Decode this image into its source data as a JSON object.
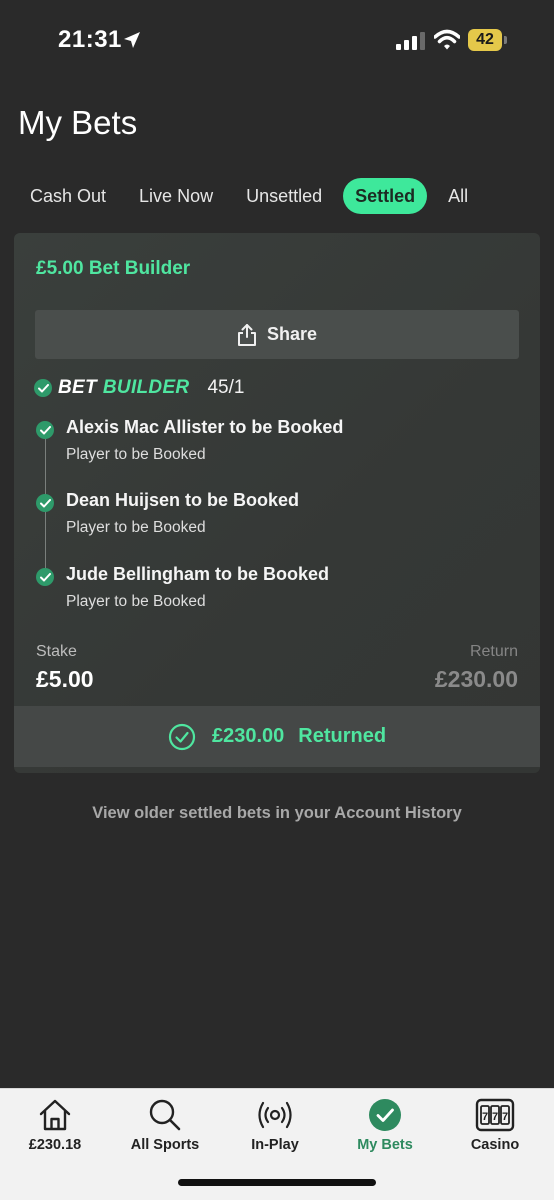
{
  "status_bar": {
    "time": "21:31",
    "battery": "42",
    "icons": [
      "location-arrow-icon",
      "signal-icon",
      "wifi-icon",
      "battery-icon"
    ]
  },
  "page": {
    "title": "My Bets"
  },
  "tabs": [
    {
      "label": "Cash Out",
      "active": false
    },
    {
      "label": "Live Now",
      "active": false
    },
    {
      "label": "Unsettled",
      "active": false
    },
    {
      "label": "Settled",
      "active": true
    },
    {
      "label": "All",
      "active": false
    }
  ],
  "bet": {
    "title": "£5.00 Bet Builder",
    "share_label": "Share",
    "builder_word1": "BET",
    "builder_word2": "BUILDER",
    "odds": "45/1",
    "legs": [
      {
        "title": "Alexis Mac Allister to be Booked",
        "subtitle": "Player to be Booked"
      },
      {
        "title": "Dean Huijsen to be Booked",
        "subtitle": "Player to be Booked"
      },
      {
        "title": "Jude Bellingham to be Booked",
        "subtitle": "Player to be Booked"
      }
    ],
    "stake_label": "Stake",
    "stake_value": "£5.00",
    "return_label": "Return",
    "return_value": "£230.00",
    "returned_amount": "£230.00",
    "returned_label": "Returned"
  },
  "history_link": "View older settled bets in your Account History",
  "bottom_nav": [
    {
      "label": "£230.18",
      "icon": "home-icon",
      "active": false
    },
    {
      "label": "All Sports",
      "icon": "search-icon",
      "active": false
    },
    {
      "label": "In-Play",
      "icon": "broadcast-icon",
      "active": false
    },
    {
      "label": "My Bets",
      "icon": "check-circle-icon",
      "active": true
    },
    {
      "label": "Casino",
      "icon": "slot-machine-icon",
      "active": false
    }
  ],
  "colors": {
    "accent": "#4fe6a0",
    "active_tab": "#3ee89b",
    "nav_active": "#2e8a5f",
    "background": "#2a2a2a",
    "battery": "#e5c84a"
  }
}
